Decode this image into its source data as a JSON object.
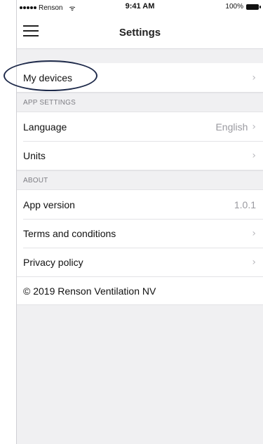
{
  "status_bar": {
    "carrier": "Renson",
    "wifi_icon": "wifi-icon",
    "time": "9:41 AM",
    "battery_percent": "100%"
  },
  "nav": {
    "title": "Settings",
    "menu_icon": "hamburger-menu-icon"
  },
  "groups": {
    "devices": {
      "items": [
        {
          "label": "My devices",
          "value": "",
          "chevron": "›"
        }
      ]
    },
    "app_settings": {
      "header": "APP SETTINGS",
      "items": [
        {
          "label": "Language",
          "value": "English",
          "chevron": "›"
        },
        {
          "label": "Units",
          "value": "",
          "chevron": "›"
        }
      ]
    },
    "about": {
      "header": "ABOUT",
      "items": [
        {
          "label": "App version",
          "value": "1.0.1",
          "chevron": ""
        },
        {
          "label": "Terms and conditions",
          "value": "",
          "chevron": "›"
        },
        {
          "label": "Privacy policy",
          "value": "",
          "chevron": "›"
        }
      ]
    }
  },
  "footer": {
    "copyright": "© 2019 Renson Ventilation NV"
  },
  "annotation": {
    "highlight_color": "#1e2a4a"
  }
}
